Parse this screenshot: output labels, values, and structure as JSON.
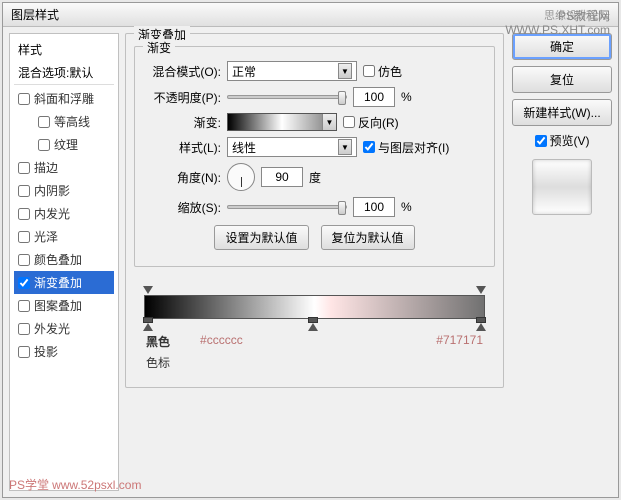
{
  "title": "图层样式",
  "header_right": "思缘设计论坛",
  "watermark_top": "PS教程网",
  "watermark_url": "WWW.PS.XHT.com",
  "sidebar": {
    "header": "样式",
    "subheader": "混合选项:默认",
    "items": [
      {
        "label": "斜面和浮雕",
        "checked": false,
        "selected": false
      },
      {
        "label": "等高线",
        "checked": false,
        "selected": false,
        "indent": true
      },
      {
        "label": "纹理",
        "checked": false,
        "selected": false,
        "indent": true
      },
      {
        "label": "描边",
        "checked": false,
        "selected": false
      },
      {
        "label": "内阴影",
        "checked": false,
        "selected": false
      },
      {
        "label": "内发光",
        "checked": false,
        "selected": false
      },
      {
        "label": "光泽",
        "checked": false,
        "selected": false
      },
      {
        "label": "颜色叠加",
        "checked": false,
        "selected": false
      },
      {
        "label": "渐变叠加",
        "checked": true,
        "selected": true
      },
      {
        "label": "图案叠加",
        "checked": false,
        "selected": false
      },
      {
        "label": "外发光",
        "checked": false,
        "selected": false
      },
      {
        "label": "投影",
        "checked": false,
        "selected": false
      }
    ]
  },
  "panel": {
    "outer_title": "渐变叠加",
    "group_title": "渐变",
    "blend_label": "混合模式(O):",
    "blend_value": "正常",
    "dither_label": "仿色",
    "opacity_label": "不透明度(P):",
    "opacity_value": "100",
    "pct": "%",
    "gradient_label": "渐变:",
    "reverse_label": "反向(R)",
    "style_label": "样式(L):",
    "style_value": "线性",
    "align_label": "与图层对齐(I)",
    "angle_label": "角度(N):",
    "angle_value": "90",
    "degree": "度",
    "scale_label": "缩放(S):",
    "scale_value": "100",
    "btn_default": "设置为默认值",
    "btn_reset": "复位为默认值"
  },
  "gradient_annotations": {
    "left": "黑色",
    "mid": "#cccccc",
    "right": "#717171",
    "stops_label": "色标"
  },
  "buttons": {
    "ok": "确定",
    "cancel": "复位",
    "new_style": "新建样式(W)...",
    "preview_label": "预览(V)"
  },
  "footer_wm": "PS学堂",
  "footer_url": "www.52psxl.com"
}
